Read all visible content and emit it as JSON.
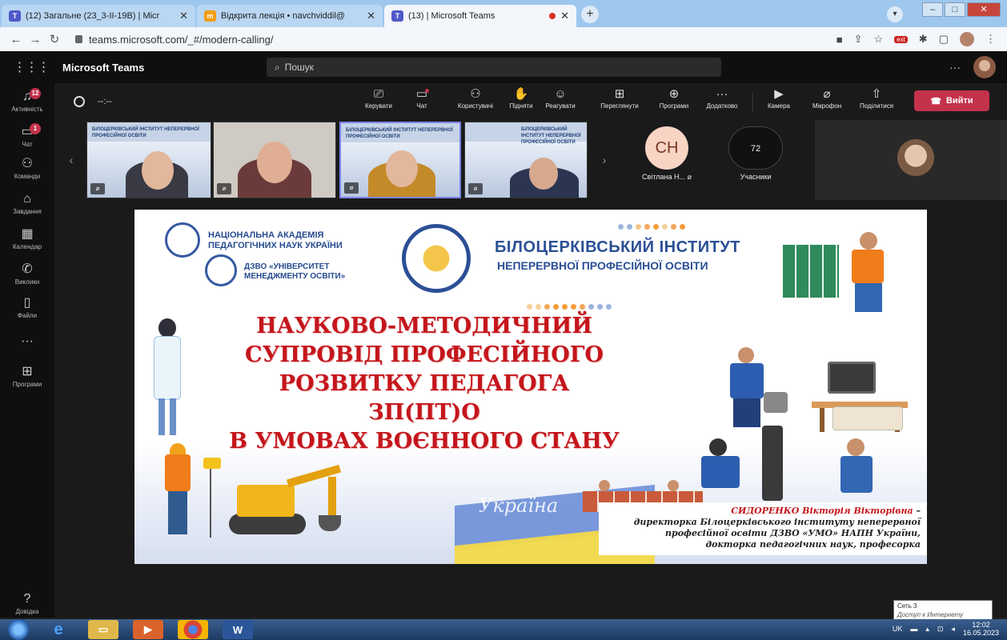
{
  "browser": {
    "tabs": [
      {
        "label": "(12) Загальне (23_3-II-19B) | Micr",
        "active": false
      },
      {
        "label": "Відкрита лекція • navchviddil@",
        "active": false
      },
      {
        "label": "(13) | Microsoft Teams",
        "active": true
      }
    ],
    "new_tab_label": "+",
    "url": "teams.microsoft.com/_#/modern-calling/"
  },
  "teams": {
    "app_title": "Microsoft Teams",
    "search_placeholder": "Пошук",
    "more_label": "···",
    "rail": [
      {
        "icon": "bell-icon",
        "label": "Активність",
        "badge": "12"
      },
      {
        "icon": "chat-icon",
        "label": "Чат",
        "badge": "1"
      },
      {
        "icon": "teams-icon",
        "label": "Команди",
        "badge": ""
      },
      {
        "icon": "assignments-icon",
        "label": "Завдання",
        "badge": ""
      },
      {
        "icon": "calendar-icon",
        "label": "Календар",
        "badge": ""
      },
      {
        "icon": "calls-icon",
        "label": "Виклики",
        "badge": ""
      },
      {
        "icon": "files-icon",
        "label": "Файли",
        "badge": ""
      },
      {
        "icon": "more-icon",
        "label": "",
        "badge": ""
      },
      {
        "icon": "apps-icon",
        "label": "Програми",
        "badge": ""
      }
    ],
    "help_label": "Довідка"
  },
  "meeting": {
    "timer": "--:--",
    "controls": [
      {
        "icon": "present-icon",
        "label": "Керувати"
      },
      {
        "icon": "chat-icon",
        "label": "Чат"
      },
      {
        "icon": "people-icon",
        "label": "Користувачі"
      },
      {
        "icon": "raise-hand-icon",
        "label": "Підняти"
      },
      {
        "icon": "react-icon",
        "label": "Реагувати"
      },
      {
        "icon": "view-icon",
        "label": "Переглянути"
      },
      {
        "icon": "apps-icon",
        "label": "Програми"
      },
      {
        "icon": "more-icon",
        "label": "Додатково"
      },
      {
        "icon": "camera-icon",
        "label": "Камера"
      },
      {
        "icon": "mic-icon",
        "label": "Мікрофон"
      },
      {
        "icon": "share-icon",
        "label": "Поділитися"
      }
    ],
    "leave_label": "Вийти",
    "participants": {
      "initials": "CH",
      "name": "Світлана Н...",
      "count": "72",
      "count_label": "Учасники"
    },
    "thumb_slide_text": "БІЛОЦЕРКІВСЬКИЙ ІНСТИТУТ НЕПЕРЕРВНОЇ ПРОФЕСІЙНОЇ ОСВІТИ"
  },
  "slide": {
    "org1": [
      "НАЦІОНАЛЬНА АКАДЕМІЯ",
      "ПЕДАГОГІЧНИХ НАУК УКРАЇНИ"
    ],
    "org2": [
      "ДЗВО «УНІВЕРСИТЕТ",
      "МЕНЕДЖМЕНТУ ОСВІТИ»"
    ],
    "institute": "БІЛОЦЕРКІВСЬКИЙ ІНСТИТУТ",
    "institute_sub": "НЕПЕРЕРВНОЇ ПРОФЕСІЙНОЇ ОСВІТИ",
    "title_lines": [
      "НАУКОВО-МЕТОДИЧНИЙ",
      "СУПРОВІД ПРОФЕСІЙНОГО",
      "РОЗВИТКУ ПЕДАГОГА ЗП(ПТ)О",
      "В УМОВАХ ВОЄННОГО СТАНУ"
    ],
    "map_word": "Україна",
    "caption_name": "СИДОРЕНКО Вікторія Вікторівна",
    "caption_dash": " –",
    "caption_lines": [
      "директорка Білоцерківського інституту неперервної",
      "професійної освіти ДЗВО «УМО» НАПН України,",
      "докторка педагогічних наук, професорка"
    ],
    "accent_red": "#c4161c",
    "accent_blue": "#2b4f95"
  },
  "tooltip": [
    "Сеть 3",
    "Доступ к Интернету"
  ],
  "taskbar": {
    "lang": "UK",
    "time": "12:02",
    "date": "16.05.2023"
  }
}
